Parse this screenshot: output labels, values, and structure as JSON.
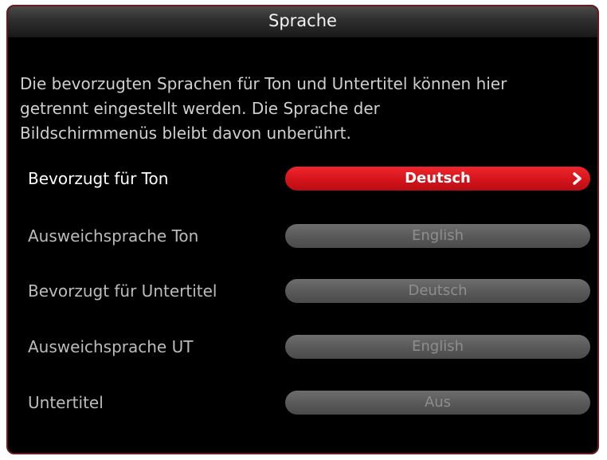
{
  "dialog": {
    "title": "Sprache",
    "intro_lines": [
      "Die bevorzugten Sprachen für Ton und Untertitel können hier",
      "getrennt eingestellt werden. Die Sprache der",
      "Bildschirmmenüs bleibt davon unberührt."
    ],
    "settings": [
      {
        "label": "Bevorzugt für Ton",
        "value": "Deutsch",
        "selected": true
      },
      {
        "label": "Ausweichsprache Ton",
        "value": "English",
        "selected": false
      },
      {
        "label": "Bevorzugt für Untertitel",
        "value": "Deutsch",
        "selected": false
      },
      {
        "label": "Ausweichsprache UT",
        "value": "English",
        "selected": false
      },
      {
        "label": "Untertitel",
        "value": "Aus",
        "selected": false
      }
    ]
  },
  "colors": {
    "accent_red": "#d5141b",
    "inactive_pill": "#5a5a5a",
    "background": "#000000",
    "border": "#6a1a1c"
  },
  "icons": {
    "selected_row_indicator": "chevron-right-icon"
  }
}
